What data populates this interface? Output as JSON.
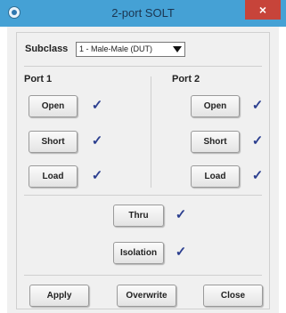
{
  "window": {
    "title": "2-port SOLT",
    "close_symbol": "×"
  },
  "subclass": {
    "label": "Subclass",
    "value": "1 - Male-Male (DUT)"
  },
  "port1": {
    "label": "Port 1",
    "buttons": [
      {
        "label": "Open",
        "checked": true
      },
      {
        "label": "Short",
        "checked": true
      },
      {
        "label": "Load",
        "checked": true
      }
    ]
  },
  "port2": {
    "label": "Port 2",
    "buttons": [
      {
        "label": "Open",
        "checked": true
      },
      {
        "label": "Short",
        "checked": true
      },
      {
        "label": "Load",
        "checked": true
      }
    ]
  },
  "thru": {
    "label": "Thru",
    "checked": true
  },
  "isolation": {
    "label": "Isolation",
    "checked": true
  },
  "check_mark": "✓",
  "footer": {
    "apply": "Apply",
    "overwrite": "Overwrite",
    "close": "Close"
  }
}
